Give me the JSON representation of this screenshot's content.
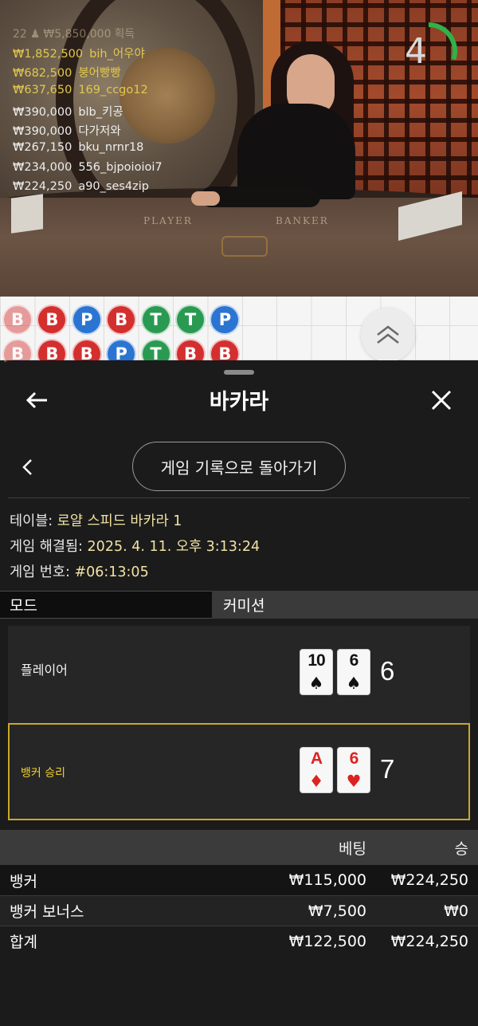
{
  "video": {
    "winners_header": {
      "count": "22",
      "total": "₩5,850,000",
      "suffix": "획득"
    },
    "winners": [
      {
        "amount": "₩1,852,500",
        "name": "bih_어우야",
        "tone": "gold"
      },
      {
        "amount": "₩682,500",
        "name": "붕어빵빵",
        "tone": "gold"
      },
      {
        "amount": "₩637,650",
        "name": "169_ccgo12",
        "tone": "gold"
      },
      {
        "amount": "₩390,000",
        "name": "blb_키공",
        "tone": "white"
      },
      {
        "amount": "₩390,000",
        "name": "다가저와",
        "tone": "white"
      },
      {
        "amount": "₩267,150",
        "name": "bku_nrnr18",
        "tone": "white"
      },
      {
        "amount": "₩234,000",
        "name": "556_bjpoioioi7",
        "tone": "white"
      },
      {
        "amount": "₩224,250",
        "name": "a90_ses4zip",
        "tone": "white"
      }
    ],
    "table_labels": {
      "player": "PLAYER",
      "banker": "BANKER"
    },
    "countdown": "4",
    "countdown_fraction": 0.3,
    "countdown_color": "#2fb24a"
  },
  "bead_road": {
    "row1": [
      "B",
      "B",
      "P",
      "B",
      "T",
      "T",
      "P"
    ],
    "row2": [
      "B",
      "B",
      "B",
      "P",
      "T",
      "B",
      "B"
    ],
    "colors": {
      "B": "#d42f2f",
      "P": "#2b74d2",
      "T": "#2a9a52"
    }
  },
  "sheet": {
    "title": "바카라",
    "back_to_history_label": "게임 기록으로 돌아가기",
    "table_label": "테이블:",
    "table_value": "로얄 스피드 바카라 1",
    "resolved_label": "게임 해결됨:",
    "resolved_value": "2025. 4. 11. 오후 3:13:24",
    "game_no_label": "게임 번호:",
    "game_no_value": "#06:13:05",
    "tabs": {
      "mode": "모드",
      "commission": "커미션"
    },
    "player": {
      "label": "플레이어",
      "cards": [
        {
          "rank": "10",
          "suit": "♠",
          "color": "black"
        },
        {
          "rank": "6",
          "suit": "♠",
          "color": "black"
        }
      ],
      "score": "6"
    },
    "banker": {
      "label": "뱅커 승리",
      "cards": [
        {
          "rank": "A",
          "suit": "♦",
          "color": "red"
        },
        {
          "rank": "6",
          "suit": "♥",
          "color": "red"
        }
      ],
      "score": "7"
    },
    "bets": {
      "header": {
        "bet": "베팅",
        "win": "승"
      },
      "rows": [
        {
          "name": "뱅커",
          "bet": "₩115,000",
          "win": "₩224,250"
        },
        {
          "name": "뱅커 보너스",
          "bet": "₩7,500",
          "win": "₩0"
        }
      ],
      "total": {
        "name": "합계",
        "bet": "₩122,500",
        "win": "₩224,250"
      }
    },
    "accent_gold": "#c9a82a"
  }
}
